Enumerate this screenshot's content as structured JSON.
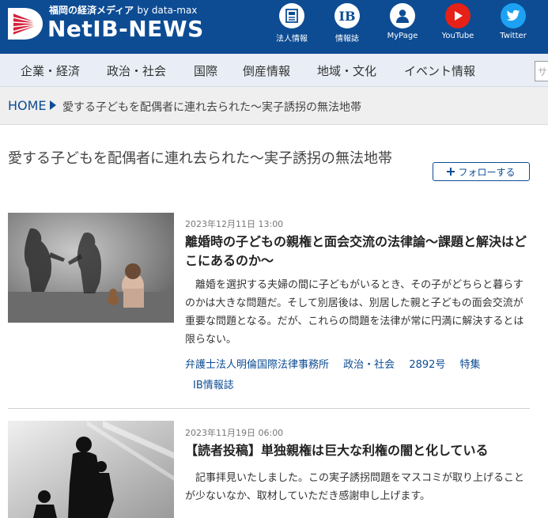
{
  "header": {
    "tagline": "福岡の経済メディア",
    "tagline_by": "by data-max",
    "brand": "NetIB-NEWS",
    "icons": [
      {
        "name": "法人情報",
        "icon": "document-icon"
      },
      {
        "name": "情報誌",
        "icon": "ib-icon"
      },
      {
        "name": "MyPage",
        "icon": "user-icon"
      },
      {
        "name": "YouTube",
        "icon": "youtube-icon"
      },
      {
        "name": "Twitter",
        "icon": "twitter-icon"
      }
    ]
  },
  "nav": {
    "items": [
      "企業・経済",
      "政治・社会",
      "国際",
      "倒産情報",
      "地域・文化",
      "イベント情報"
    ],
    "search_placeholder": "サ"
  },
  "breadcrumb": {
    "home": "HOME",
    "current": "愛する子どもを配偶者に連れ去られた～実子誘拐の無法地帯"
  },
  "page": {
    "title": "愛する子どもを配偶者に連れ去られた～実子誘拐の無法地帯",
    "follow_label": "フォローする"
  },
  "articles": [
    {
      "date": "2023年12月11日 13:00",
      "title": "離婚時の子どもの親権と面会交流の法律論～課題と解決はどこにあるのか～",
      "summary": "離婚を選択する夫婦の間に子どもがいるとき、その子がどちらと暮らすのかは大きな問題だ。そして別居後は、別居した親と子どもの面会交流が重要な問題となる。だが、これらの問題を法律が常に円満に解決するとは限らない。",
      "tags": [
        "弁護士法人明倫国際法律事務所",
        "政治・社会",
        "2892号",
        "特集",
        "IB情報誌"
      ]
    },
    {
      "date": "2023年11月19日 06:00",
      "title": "【読者投稿】単独親権は巨大な利権の闇と化している",
      "summary": "記事拝見いたしました。この実子誘拐問題をマスコミが取り上げることが少ないなか、取材していただき感謝申し上げます。",
      "tags": []
    }
  ],
  "colors": {
    "header_bg": "#0d4c93",
    "nav_bg": "#e9eef6",
    "link": "#0d4c93",
    "logo_red": "#d3223b"
  }
}
